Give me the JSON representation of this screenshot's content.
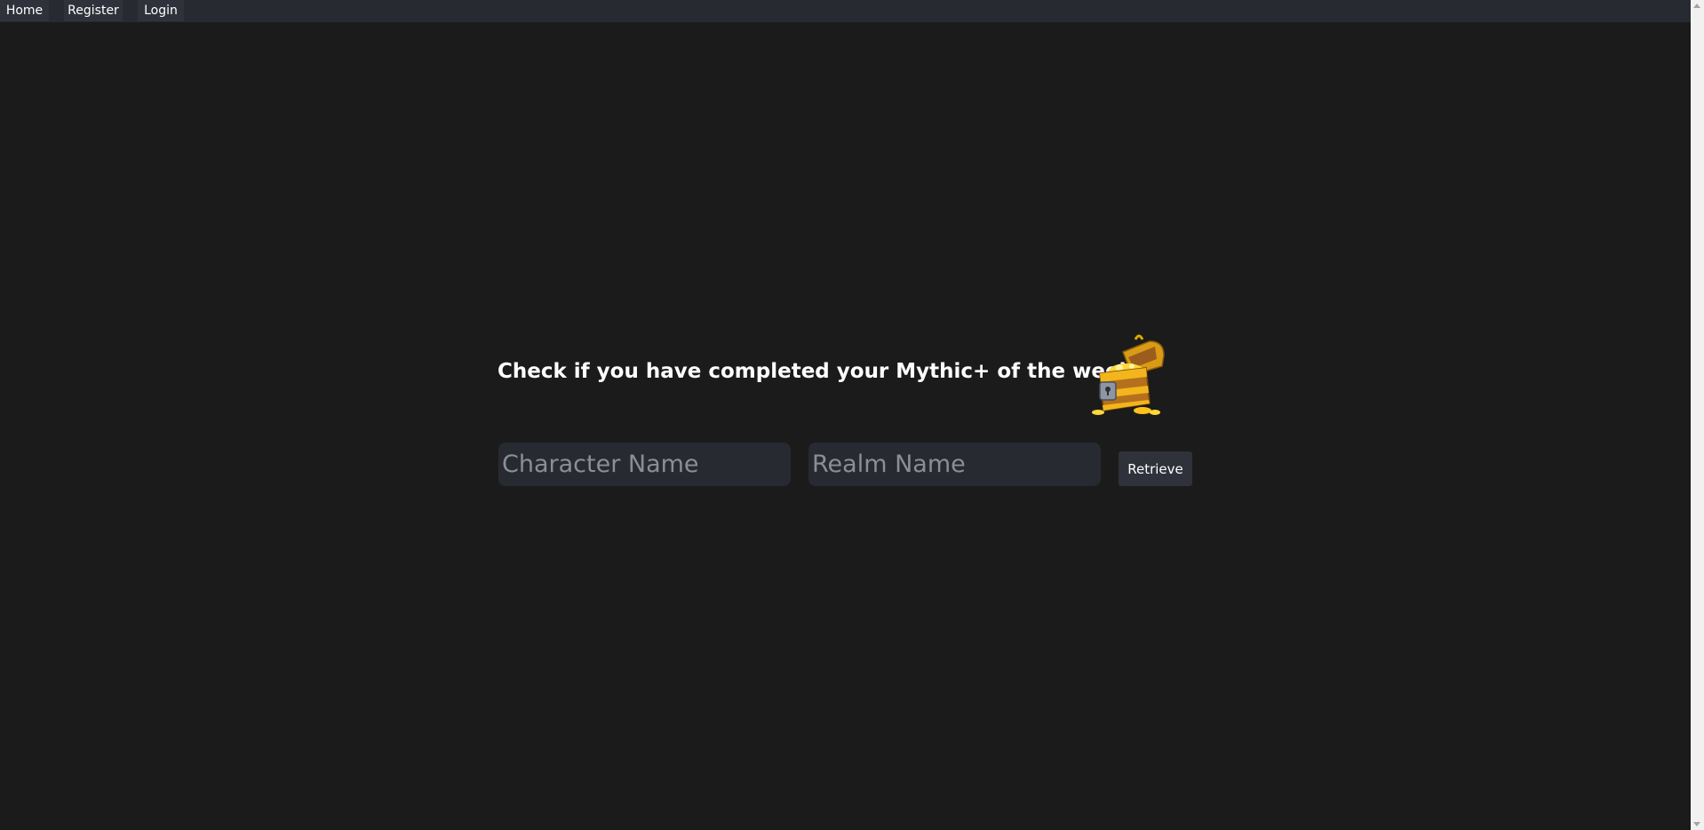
{
  "nav": {
    "home_label": "Home",
    "register_label": "Register",
    "login_label": "Login"
  },
  "main": {
    "headline": "Check if you have completed your Mythic+ of the week!",
    "chest_icon": "treasure-chest-icon",
    "character_field": {
      "value": "",
      "placeholder": "Character Name"
    },
    "realm_field": {
      "value": "",
      "placeholder": "Realm Name"
    },
    "retrieve_label": "Retrieve"
  },
  "colors": {
    "background": "#1b1b1b",
    "navbar": "#272a30",
    "button": "#2f323a",
    "input": "#272a31",
    "text": "#ffffff",
    "chest_gold": "#f5c518"
  }
}
